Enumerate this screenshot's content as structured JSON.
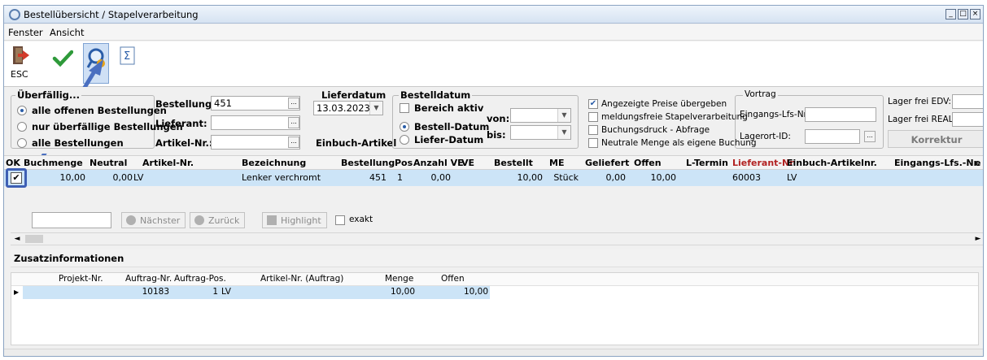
{
  "window": {
    "title": "Bestellübersicht / Stapelverarbeitung"
  },
  "menu": [
    "Fenster",
    "Ansicht"
  ],
  "toolbar": {
    "esc_label": "ESC"
  },
  "filters": {
    "group1_title": "Überfällig...",
    "radio_all_open": "alle offenen Bestellungen",
    "radio_only_overdue": "nur überfällige Bestellungen",
    "radio_all": "alle Bestellungen",
    "bestellung_label": "Bestellung:",
    "bestellung_value": "451",
    "lieferant_label": "Lieferant:",
    "lieferant_value": "",
    "artikel_label": "Artikel-Nr.:",
    "artikel_value": "",
    "lieferdatum_title": "Lieferdatum",
    "lieferdatum_value": "13.03.2023",
    "einbuch_label": "Einbuch-Artikel",
    "bestelldatum_title": "Bestelldatum",
    "bereich_aktiv": "Bereich aktiv",
    "radio_bestell_datum": "Bestell-Datum",
    "radio_liefer_datum": "Liefer-Datum",
    "von_label": "von:",
    "bis_label": "bis:",
    "opt_preise": "Angezeigte Preise übergeben",
    "opt_meldungsfrei": "meldungsfreie Stapelverarbeitung",
    "opt_buchungsdruck": "Buchungsdruck - Abfrage",
    "opt_neutrale": "Neutrale Menge als eigene Buchung",
    "vortrag_title": "Vortrag",
    "eingangs_label": "Eingangs-Lfs-Nr.:",
    "lagerort_label": "Lagerort-ID:",
    "lager_edv_label": "Lager frei EDV:",
    "lager_real_label": "Lager frei REAL:",
    "korrektur_button": "Korrektur"
  },
  "grid": {
    "headers": [
      "OK",
      "Buchmenge",
      "Neutral",
      "Artikel-Nr.",
      "Bezeichnung",
      "Bestellung",
      "Pos",
      "Anzahl VE",
      "VE",
      "Bestellt",
      "ME",
      "Geliefert",
      "Offen",
      "L-Termin",
      "Lieferant-Nr",
      "Einbuch-Artikelnr.",
      "Eingangs-Lfs.-Nr.",
      "e"
    ],
    "rows": [
      {
        "buchmenge": "10,00",
        "neutral": "0,00",
        "artikel": "LV",
        "bezeichnung": "Lenker verchromt",
        "bestellung": "451",
        "pos": "1",
        "anzahl_ve": "0,00",
        "ve": "",
        "bestellt": "10,00",
        "me": "Stück",
        "geliefert": "0,00",
        "offen": "10,00",
        "l_termin": "",
        "lieferant": "60003",
        "einbuch": "LV",
        "eingangs": ""
      }
    ],
    "lieferant_color": "#b22222"
  },
  "search": {
    "naechster": "Nächster",
    "zurueck": "Zurück",
    "highlight": "Highlight",
    "exakt": "exakt"
  },
  "zusatz": {
    "title": "Zusatzinformationen",
    "headers": [
      "Projekt-Nr.",
      "Auftrag-Nr.",
      "Auftrag-Pos.",
      "Artikel-Nr. (Auftrag)",
      "Menge",
      "Offen"
    ],
    "rows": [
      {
        "projekt": "",
        "auftrag_nr": "10183",
        "auftrag_pos": "1",
        "artikel": "LV",
        "menge": "10,00",
        "offen": "10,00"
      }
    ]
  }
}
